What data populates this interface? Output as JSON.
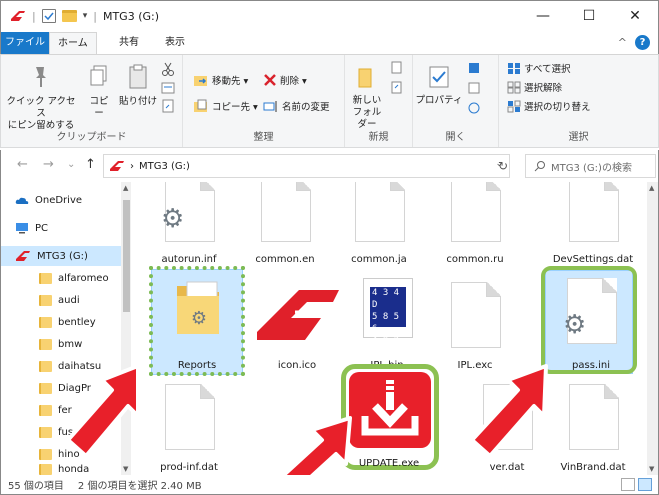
{
  "title_bar": {
    "title": "MTG3 (G:)",
    "separator": "|",
    "dropdown": "▾",
    "controls": {
      "minimize": "—",
      "maximize": "☐",
      "close": "✕"
    }
  },
  "ribbon_tabs": [
    "ファイル",
    "ホーム",
    "共有",
    "表示"
  ],
  "ribbon_right": {
    "collapse": "^",
    "help": "?"
  },
  "ribbon": {
    "clipboard": {
      "pin_label": "クイック アクセス\nにピン留めする",
      "copy_label": "コピー",
      "paste_label": "貼り付け",
      "group_label": "クリップボード"
    },
    "organize": {
      "move_to": "移動先 ▾",
      "copy_to": "コピー先 ▾",
      "delete": "削除 ▾",
      "rename": "名前の変更",
      "group_label": "整理"
    },
    "new": {
      "new_folder": "新しい\nフォルダー",
      "group_label": "新規"
    },
    "open": {
      "properties": "プロパティ",
      "group_label": "開く"
    },
    "select": {
      "select_all": "すべて選択",
      "select_none": "選択解除",
      "invert": "選択の切り替え",
      "group_label": "選択"
    }
  },
  "address_bar": {
    "back": "←",
    "forward": "→",
    "recent": "⌄",
    "up": "↑",
    "path_sep": "›",
    "path": "MTG3 (G:)",
    "dropdown": "⌄",
    "refresh": "↻",
    "search_placeholder": "MTG3 (G:)の検索"
  },
  "nav_pane": {
    "items": [
      {
        "label": "OneDrive",
        "icon": "cloud-icon"
      },
      {
        "label": "PC",
        "icon": "pc-icon"
      },
      {
        "label": "MTG3 (G:)",
        "icon": "drive-logo-icon",
        "selected": true
      },
      {
        "label": "alfaromeo",
        "icon": "folder-icon"
      },
      {
        "label": "audi",
        "icon": "folder-icon"
      },
      {
        "label": "bentley",
        "icon": "folder-icon"
      },
      {
        "label": "bmw",
        "icon": "folder-icon"
      },
      {
        "label": "daihatsu",
        "icon": "folder-icon"
      },
      {
        "label": "DiagPr",
        "icon": "folder-icon"
      },
      {
        "label": "fer",
        "icon": "folder-icon"
      },
      {
        "label": "fus",
        "icon": "folder-icon"
      },
      {
        "label": "hino",
        "icon": "folder-icon"
      },
      {
        "label": "honda",
        "icon": "folder-icon"
      }
    ]
  },
  "files": [
    {
      "label": "autorun.inf",
      "type": "gear-doc"
    },
    {
      "label": "common.en",
      "type": "doc"
    },
    {
      "label": "common.ja",
      "type": "doc"
    },
    {
      "label": "common.ru",
      "type": "doc"
    },
    {
      "label": "DevSettings.dat",
      "type": "doc"
    },
    {
      "label": "Reports",
      "type": "folder",
      "selected": true
    },
    {
      "label": "icon.ico",
      "type": "logo"
    },
    {
      "label": "IPL.bin",
      "type": "bin"
    },
    {
      "label": "IPL.exc",
      "type": "doc"
    },
    {
      "label": "pass.ini",
      "type": "gear-doc",
      "selected": true
    },
    {
      "label": "prod-inf.dat",
      "type": "doc"
    },
    {
      "label": "UPDATE.exe",
      "type": "update"
    },
    {
      "label": "ver.dat",
      "type": "doc"
    },
    {
      "label": "VinBrand.dat",
      "type": "doc"
    }
  ],
  "bin_icon_text": [
    "4 3 4 D",
    "5 8 5 6",
    "4 9 2 0"
  ],
  "status_bar": {
    "count": "55 個の項目",
    "selection": "2 個の項目を選択 2.40 MB"
  },
  "colors": {
    "accent": "#1979ca",
    "selection": "#cce8ff",
    "highlight_dotted": "#7dbb55",
    "highlight_solid": "#8cc152",
    "arrow_red": "#e8202a",
    "update_red": "#e8202a",
    "logo_red": "#e0202a"
  }
}
